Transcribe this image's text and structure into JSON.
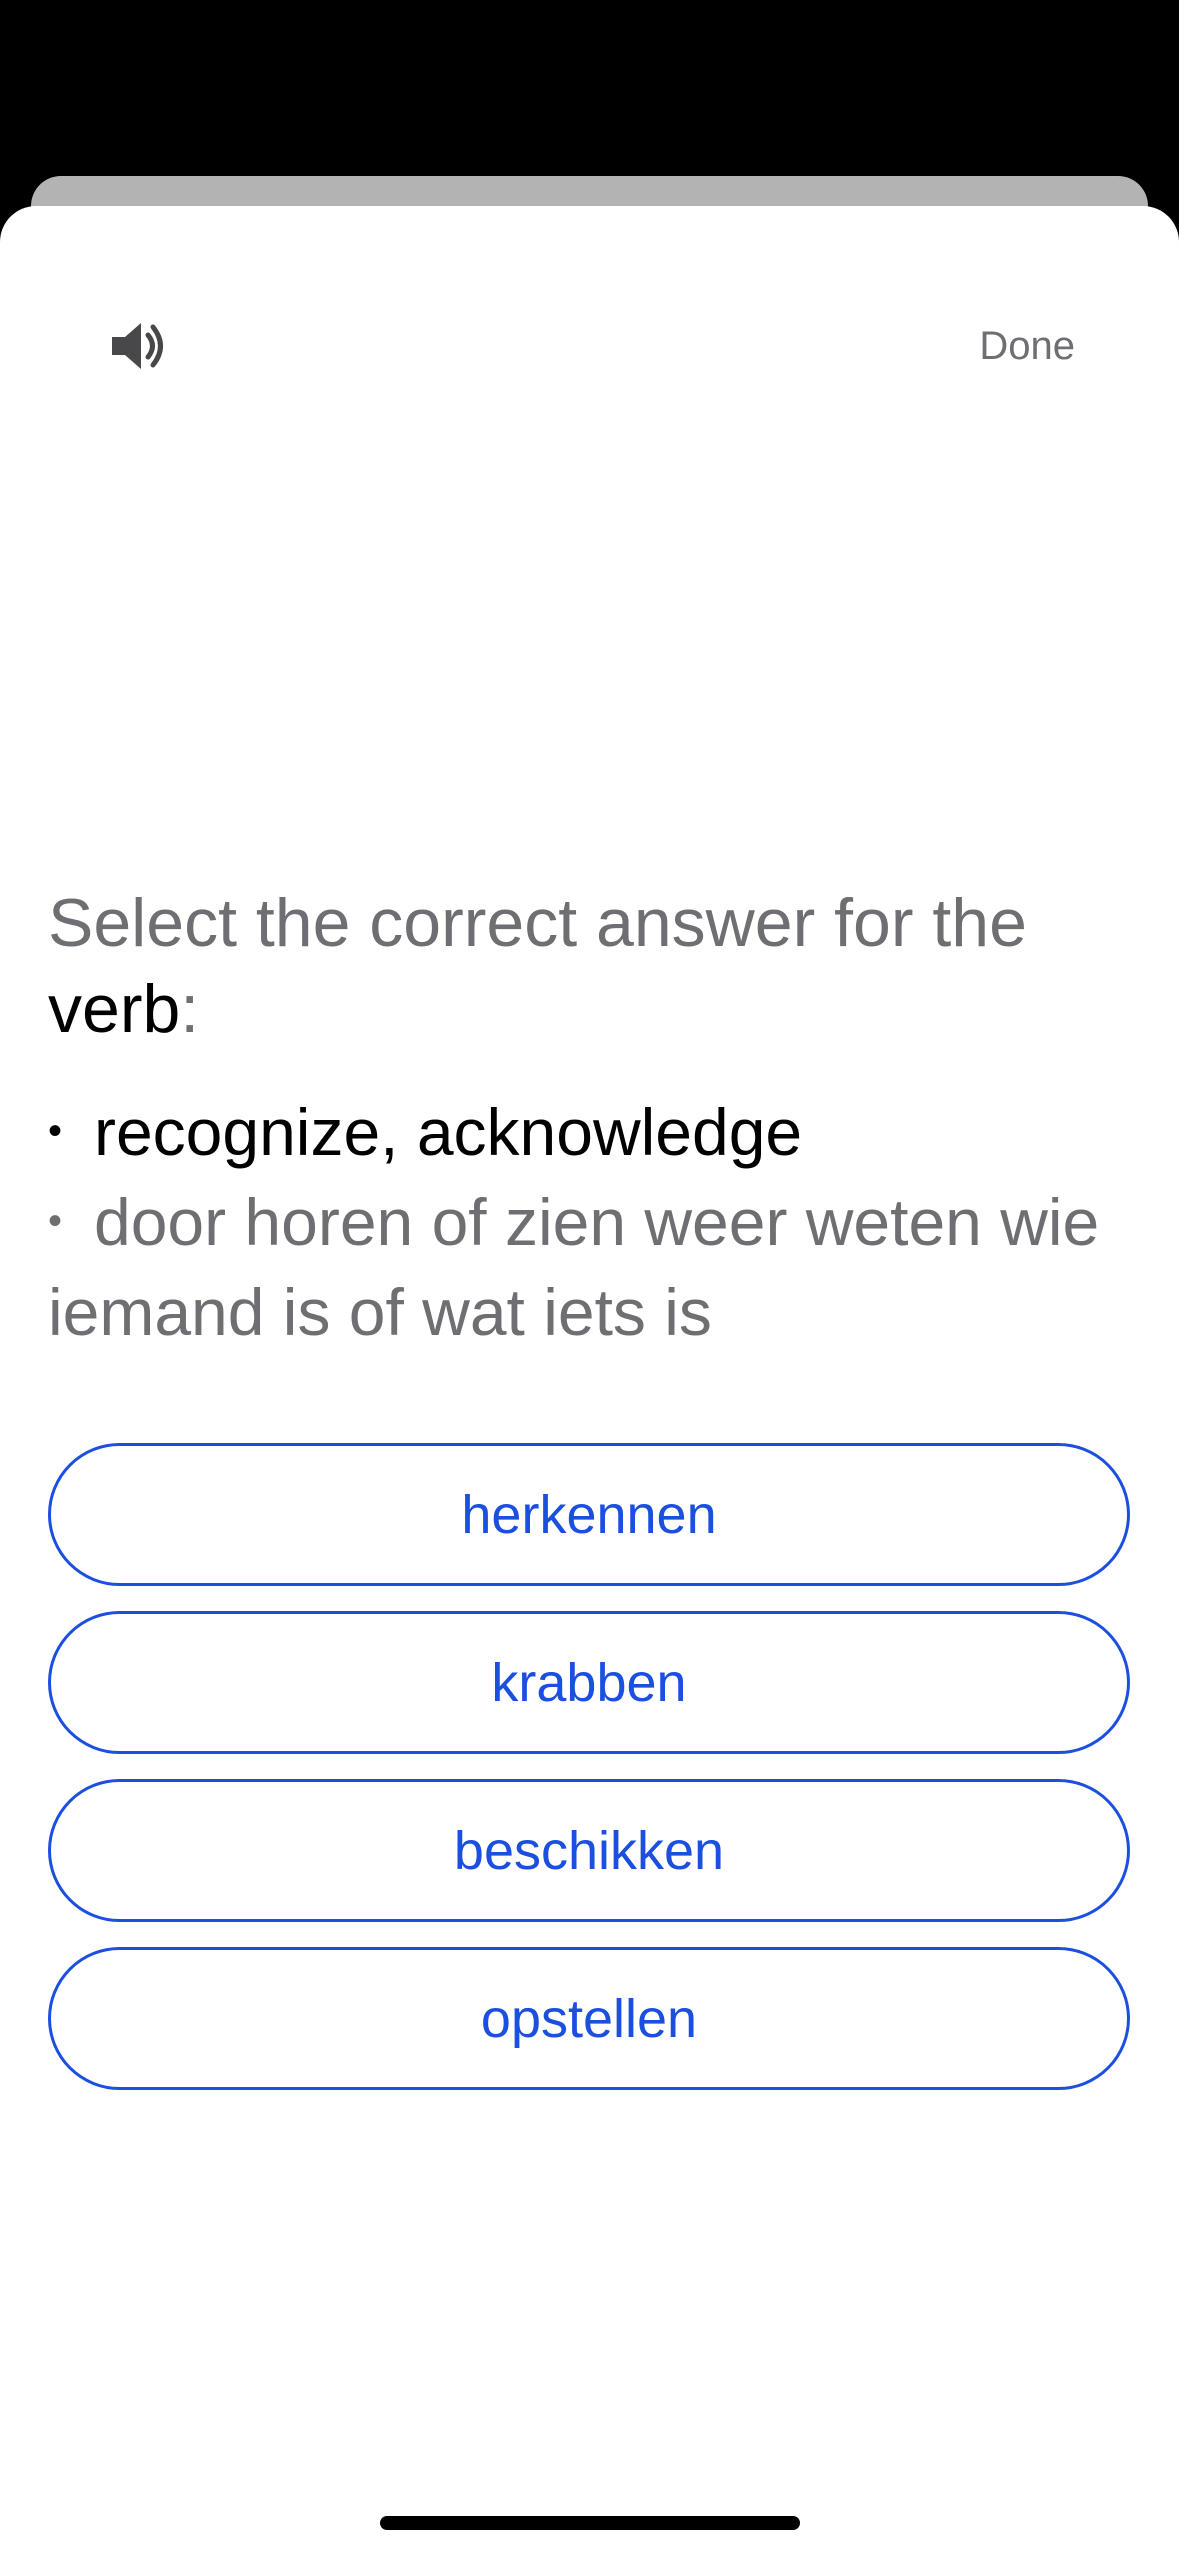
{
  "header": {
    "speaker_icon": "speaker-volume-icon",
    "done_label": "Done"
  },
  "question": {
    "prompt_text": "Select the correct answer for the ",
    "part_of_speech": "verb",
    "prompt_suffix": ":"
  },
  "definitions": {
    "bullet": "•",
    "english": "recognize, acknowledge",
    "dutch": "door horen of zien weer weten wie iemand is of wat iets is"
  },
  "answers": [
    {
      "label": "herkennen"
    },
    {
      "label": "krabben"
    },
    {
      "label": "beschikken"
    },
    {
      "label": "opstellen"
    }
  ],
  "colors": {
    "accent": "#1a4fe0",
    "secondary_text": "#6e6e73",
    "primary_text": "#000000",
    "backdrop": "#000000",
    "back_sheet": "#b3b3b3",
    "sheet": "#ffffff"
  }
}
